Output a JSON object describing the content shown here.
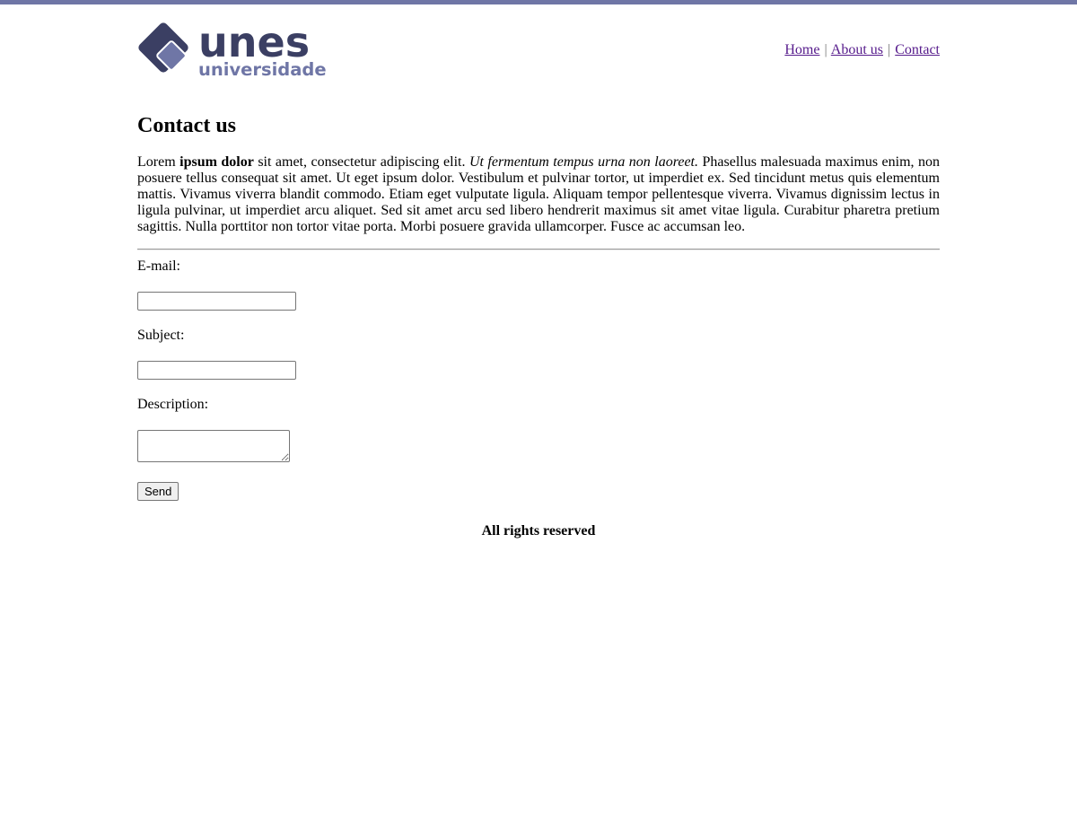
{
  "brand": {
    "logo_word": "unes",
    "logo_sub": "universidade",
    "colors": {
      "dark": "#3b3f63",
      "light": "#6f76a6"
    }
  },
  "nav": {
    "items": [
      {
        "label": "Home"
      },
      {
        "label": "About us"
      },
      {
        "label": "Contact"
      }
    ],
    "separator": "|"
  },
  "page": {
    "title": "Contact us",
    "intro": {
      "part1": "Lorem ",
      "bold": "ipsum dolor",
      "part2": " sit amet, consectetur adipiscing elit. ",
      "italic": "Ut fermentum tempus urna non laoreet.",
      "part3": " Phasellus malesuada maximus enim, non posuere tellus consequat sit amet. Ut eget ipsum dolor. Vestibulum et pulvinar tortor, ut imperdiet ex. Sed tincidunt metus quis elementum mattis. Vivamus viverra blandit commodo. Etiam eget vulputate ligula. Aliquam tempor pellentesque viverra. Vivamus dignissim lectus in ligula pulvinar, ut imperdiet arcu aliquet. Sed sit amet arcu sed libero hendrerit maximus sit amet vitae ligula. Curabitur pharetra pretium sagittis. Nulla porttitor non tortor vitae porta. Morbi posuere gravida ullamcorper. Fusce ac accumsan leo."
    }
  },
  "form": {
    "email_label": "E-mail:",
    "email_value": "",
    "subject_label": "Subject:",
    "subject_value": "",
    "description_label": "Description:",
    "description_value": "",
    "send_label": "Send"
  },
  "footer": {
    "text": "All rights reserved"
  }
}
